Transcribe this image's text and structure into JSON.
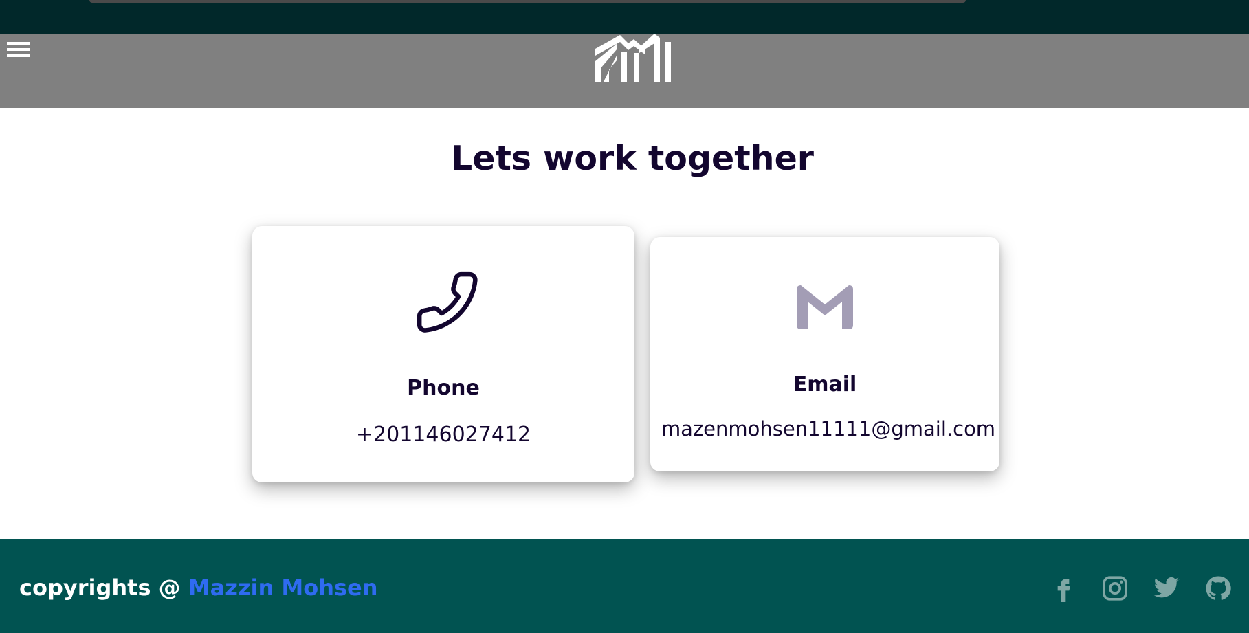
{
  "header": {
    "menu_icon": "hamburger-menu-icon",
    "logo_icon": "mm-logo-icon"
  },
  "main": {
    "title": "Lets work together",
    "cards": [
      {
        "icon": "phone-icon",
        "heading": "Phone",
        "value": "+201146027412"
      },
      {
        "icon": "gmail-icon",
        "heading": "Email",
        "value": "mazenmohsen11111@gmail.com"
      }
    ]
  },
  "footer": {
    "copyright_prefix": "copyrights @ ",
    "author": "Mazzin Mohsen",
    "social_icons": [
      "facebook-icon",
      "instagram-icon",
      "twitter-icon",
      "github-icon"
    ]
  },
  "colors": {
    "top_strip": "#01282a",
    "navbar": "#808080",
    "title_text": "#13062f",
    "footer": "#015351",
    "author_link": "#2f6bf0",
    "social_icons": "#7ea6a4",
    "gmail_icon": "#a39db5"
  }
}
